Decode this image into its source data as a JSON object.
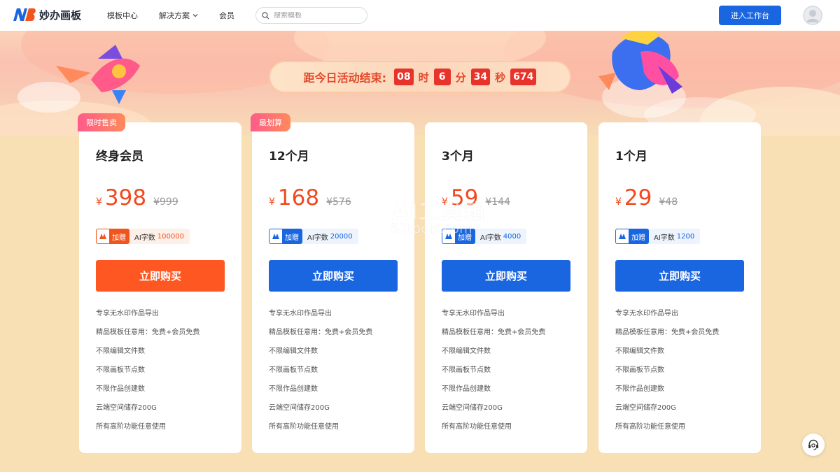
{
  "header": {
    "brand": "妙办画板",
    "nav": [
      {
        "label": "模板中心"
      },
      {
        "label": "解决方案"
      },
      {
        "label": "会员"
      }
    ],
    "search_placeholder": "搜索模板",
    "cta_label": "进入工作台"
  },
  "countdown": {
    "label": "距今日活动结束:",
    "hours": "08",
    "hours_unit": "时",
    "minutes": "6",
    "minutes_unit": "分",
    "seconds": "34",
    "seconds_unit": "秒",
    "millis": "674"
  },
  "cards": [
    {
      "badge": "限时售卖",
      "title": "终身会员",
      "currency": "¥",
      "price": "398",
      "old_price": "¥999",
      "gift_label": "加赠",
      "gift_text": "AI字数",
      "gift_num": "100000",
      "button": "立即购买",
      "accent": "#ff5722"
    },
    {
      "badge": "最划算",
      "title": "12个月",
      "currency": "¥",
      "price": "168",
      "old_price": "¥576",
      "gift_label": "加赠",
      "gift_text": "AI字数",
      "gift_num": "20000",
      "button": "立即购买",
      "accent": "#1a66e0"
    },
    {
      "badge": "",
      "title": "3个月",
      "currency": "¥",
      "price": "59",
      "old_price": "¥144",
      "gift_label": "加赠",
      "gift_text": "AI字数",
      "gift_num": "4000",
      "button": "立即购买",
      "accent": "#1a66e0"
    },
    {
      "badge": "",
      "title": "1个月",
      "currency": "¥",
      "price": "29",
      "old_price": "¥48",
      "gift_label": "加赠",
      "gift_text": "AI字数",
      "gift_num": "1200",
      "button": "立即购买",
      "accent": "#1a66e0"
    }
  ],
  "features": [
    "专享无水印作品导出",
    "精品模板任意用：免费+会员免费",
    "不限编辑文件数",
    "不限画板节点数",
    "不限作品创建数",
    "云端空间储存200G",
    "所有高阶功能任意使用"
  ],
  "watermark": {
    "main": "AI工具箱",
    "sub": "51tools.com"
  },
  "icons": {
    "logo": "nb-logo-icon",
    "search": "search-icon",
    "chevron": "chevron-down-icon",
    "avatar": "user-avatar-icon",
    "gift": "ai-gift-icon",
    "support": "customer-support-icon"
  }
}
